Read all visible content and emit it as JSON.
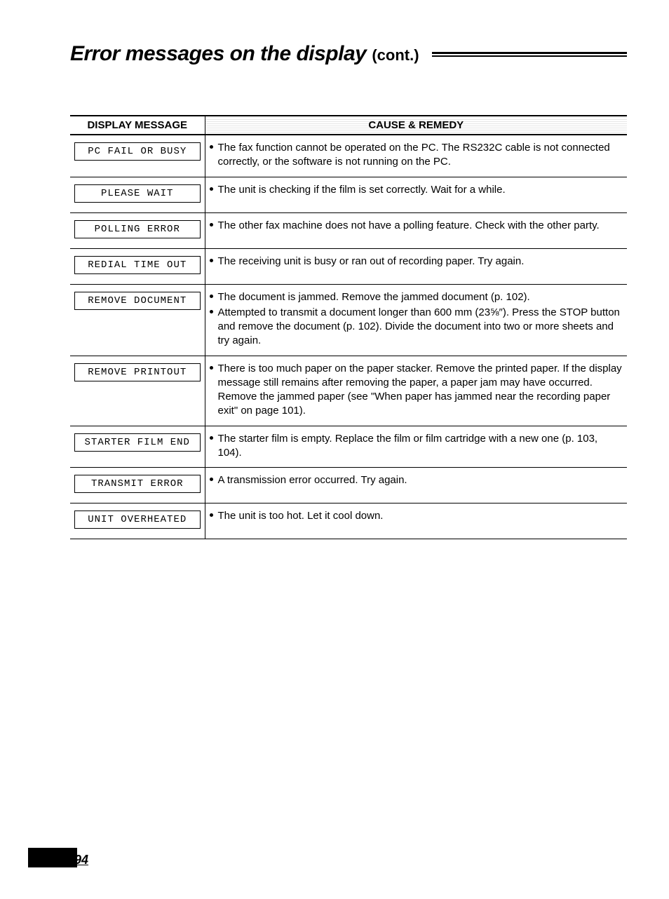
{
  "title": {
    "main": "Error messages on the display",
    "sub": "(cont.)"
  },
  "headers": {
    "message": "DISPLAY MESSAGE",
    "remedy": "CAUSE & REMEDY"
  },
  "rows": [
    {
      "msg": "PC FAIL OR BUSY",
      "remedy": [
        "The fax function cannot be operated on the PC. The RS232C cable is not connected correctly, or the software is not running on the PC."
      ]
    },
    {
      "msg": "PLEASE WAIT",
      "remedy": [
        "The unit is checking if the film is set correctly. Wait for a while."
      ]
    },
    {
      "msg": "POLLING ERROR",
      "remedy": [
        "The other fax machine does not have a polling feature. Check with the other party."
      ]
    },
    {
      "msg": "REDIAL TIME OUT",
      "remedy": [
        "The receiving unit is busy or ran out of recording paper. Try again."
      ]
    },
    {
      "msg": "REMOVE DOCUMENT",
      "remedy": [
        "The document is jammed. Remove the jammed document (p. 102).",
        "Attempted to transmit a document longer than 600 mm (23⅝″). Press the STOP button and remove the document (p. 102). Divide the document into two or more sheets and try again."
      ]
    },
    {
      "msg": "REMOVE PRINTOUT",
      "remedy": [
        "There is too much paper on the paper stacker. Remove the printed paper. If the display message still remains after removing the paper, a paper jam may have occurred. Remove the jammed paper (see \"When paper has jammed near the recording paper exit\" on page 101)."
      ]
    },
    {
      "msg": "STARTER FILM END",
      "remedy": [
        "The starter film is empty. Replace the film or film cartridge with a new one (p. 103, 104)."
      ]
    },
    {
      "msg": "TRANSMIT ERROR",
      "remedy": [
        "A transmission error occurred. Try again."
      ]
    },
    {
      "msg": "UNIT OVERHEATED",
      "remedy": [
        "The unit is too hot. Let it cool down."
      ]
    }
  ],
  "pageNumber": "94"
}
